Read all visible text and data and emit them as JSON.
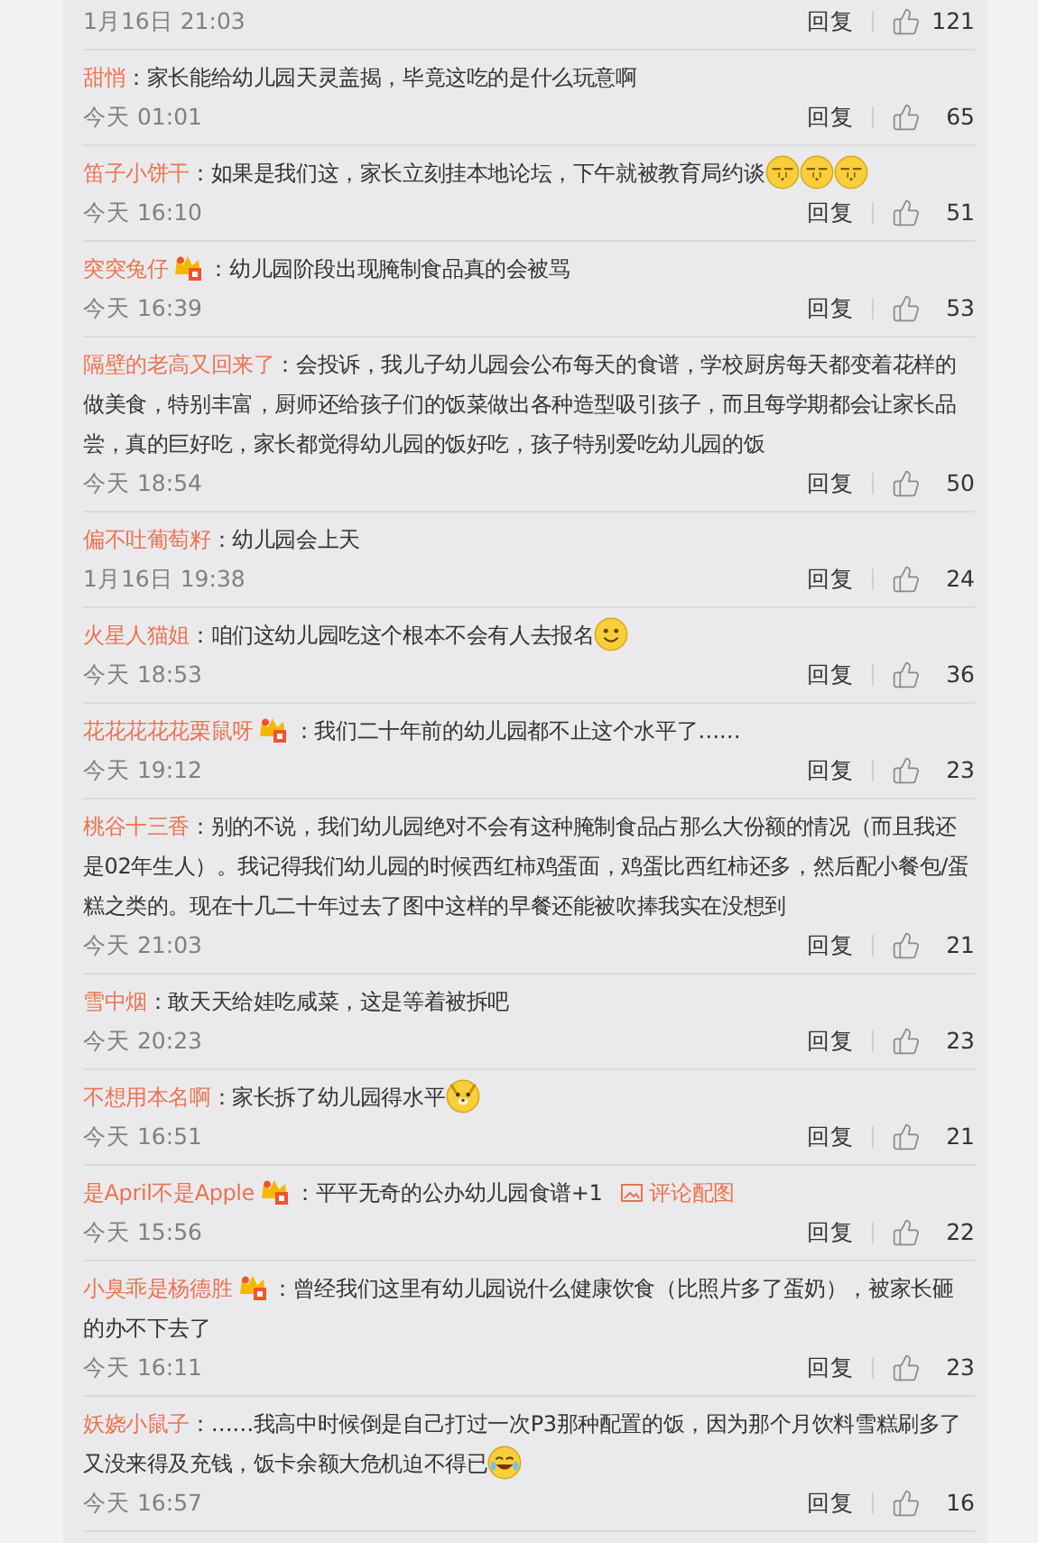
{
  "comments": [
    {
      "time": "1月16日 21:03",
      "reply": "回复",
      "likes": "121"
    },
    {
      "author": "甜悄",
      "sep": "：",
      "text": "家长能给幼儿园天灵盖揭，毕竟这吃的是什么玩意啊",
      "time": "今天 01:01",
      "reply": "回复",
      "likes": "65"
    },
    {
      "author": "笛子小饼干",
      "sep": "：",
      "text": "如果是我们这，家长立刻挂本地论坛，下午就被教育局约谈",
      "emojis": [
        {
          "kind": "sleepy"
        },
        {
          "kind": "sleepy"
        },
        {
          "kind": "sleepy"
        }
      ],
      "time": "今天 16:10",
      "reply": "回复",
      "likes": "51"
    },
    {
      "author": "突突兔仔",
      "vip": true,
      "sep": "：",
      "text": "幼儿园阶段出现腌制食品真的会被骂",
      "time": "今天 16:39",
      "reply": "回复",
      "likes": "53"
    },
    {
      "author": "隔壁的老高又回来了",
      "sep": "：",
      "text": "会投诉，我儿子幼儿园会公布每天的食谱，学校厨房每天都变着花样的做美食，特别丰富，厨师还给孩子们的饭菜做出各种造型吸引孩子，而且每学期都会让家长品尝，真的巨好吃，家长都觉得幼儿园的饭好吃，孩子特别爱吃幼儿园的饭",
      "time": "今天 18:54",
      "reply": "回复",
      "likes": "50"
    },
    {
      "author": "偏不吐葡萄籽",
      "sep": "：",
      "text": "幼儿园会上天",
      "time": "1月16日 19:38",
      "reply": "回复",
      "likes": "24"
    },
    {
      "author": "火星人猫姐",
      "sep": "：",
      "text": "咱们这幼儿园吃这个根本不会有人去报名",
      "emojis": [
        {
          "kind": "smile"
        }
      ],
      "time": "今天 18:53",
      "reply": "回复",
      "likes": "36"
    },
    {
      "author": "花花花花花栗鼠呀",
      "vip": true,
      "sep": "：",
      "text": "我们二十年前的幼儿园都不止这个水平了……",
      "time": "今天 19:12",
      "reply": "回复",
      "likes": "23"
    },
    {
      "author": "桃谷十三香",
      "sep": "：",
      "text": "别的不说，我们幼儿园绝对不会有这种腌制食品占那么大份额的情况（而且我还是02年生人）。我记得我们幼儿园的时候西红柿鸡蛋面，鸡蛋比西红柿还多，然后配小餐包/蛋糕之类的。现在十几二十年过去了图中这样的早餐还能被吹捧我实在没想到",
      "time": "今天 21:03",
      "reply": "回复",
      "likes": "21"
    },
    {
      "author": "雪中烟",
      "sep": "：",
      "text": "敢天天给娃吃咸菜，这是等着被拆吧",
      "time": "今天 20:23",
      "reply": "回复",
      "likes": "23"
    },
    {
      "author": "不想用本名啊",
      "sep": "：",
      "text": "家长拆了幼儿园得水平",
      "emojis": [
        {
          "kind": "dog"
        }
      ],
      "time": "今天 16:51",
      "reply": "回复",
      "likes": "21"
    },
    {
      "author": "是April不是Apple",
      "vip": true,
      "sep": "：",
      "text": "平平无奇的公办幼儿园食谱+1",
      "attachment": "评论配图",
      "time": "今天 15:56",
      "reply": "回复",
      "likes": "22"
    },
    {
      "author": "小臭乖是杨德胜",
      "vip": true,
      "sep": "：",
      "text": "曾经我们这里有幼儿园说什么健康饮食（比照片多了蛋奶），被家长砸的办不下去了",
      "time": "今天 16:11",
      "reply": "回复",
      "likes": "23"
    },
    {
      "author": "妖娆小鼠子",
      "sep": "：",
      "text": "……我高中时候倒是自己打过一次P3那种配置的饭，因为那个月饮料雪糕刷多了又没来得及充钱，饭卡余额大危机迫不得已",
      "emojis": [
        {
          "kind": "laugh-cry"
        }
      ],
      "time": "今天 16:57",
      "reply": "回复",
      "likes": "16"
    }
  ]
}
